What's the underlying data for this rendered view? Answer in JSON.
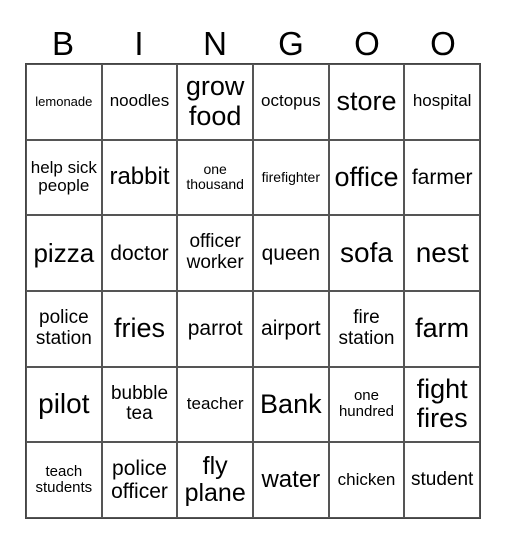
{
  "header": [
    "B",
    "I",
    "N",
    "G",
    "O",
    "O"
  ],
  "cells": [
    [
      "lemonade",
      "noodles",
      "grow food",
      "octopus",
      "store",
      "hospital"
    ],
    [
      "help sick people",
      "rabbit",
      "one thousand",
      "firefighter",
      "office",
      "farmer"
    ],
    [
      "pizza",
      "doctor",
      "officer worker",
      "queen",
      "sofa",
      "nest"
    ],
    [
      "police station",
      "fries",
      "parrot",
      "airport",
      "fire station",
      "farm"
    ],
    [
      "pilot",
      "bubble tea",
      "teacher",
      "Bank",
      "one hundred",
      "fight fires"
    ],
    [
      "teach students",
      "police officer",
      "fly plane",
      "water",
      "chicken",
      "student"
    ]
  ]
}
